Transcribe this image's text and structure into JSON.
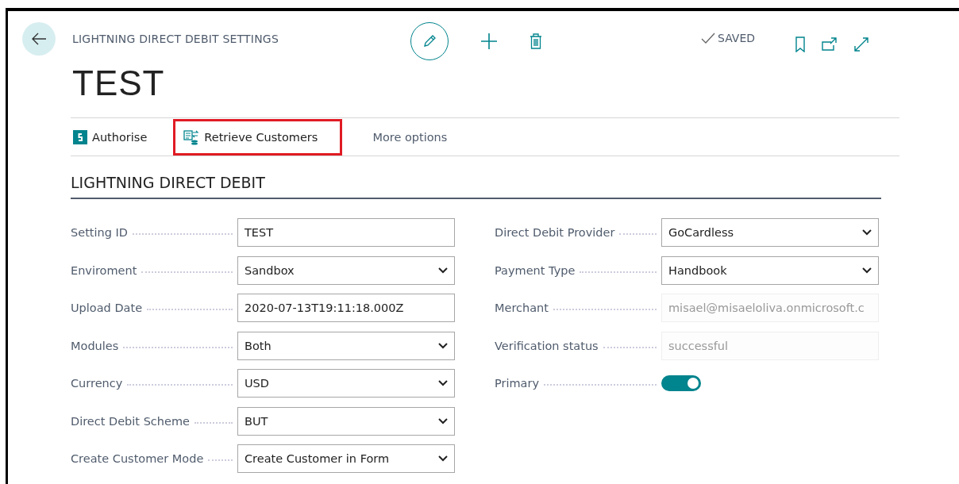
{
  "header": {
    "caption": "LIGHTNING DIRECT DEBIT SETTINGS",
    "title": "TEST",
    "status": "SAVED"
  },
  "actions": [
    {
      "label": "Authorise",
      "kind": "authorise",
      "highlighted": false
    },
    {
      "label": "Retrieve Customers",
      "kind": "retrieve",
      "highlighted": true
    },
    {
      "label": "More options",
      "kind": "more",
      "highlighted": false
    }
  ],
  "section": {
    "title": "LIGHTNING DIRECT DEBIT",
    "left": [
      {
        "label": "Setting ID",
        "kind": "text",
        "value": "TEST"
      },
      {
        "label": "Enviroment",
        "kind": "select",
        "value": "Sandbox"
      },
      {
        "label": "Upload Date",
        "kind": "text",
        "value": "2020-07-13T19:11:18.000Z"
      },
      {
        "label": "Modules",
        "kind": "select",
        "value": "Both"
      },
      {
        "label": "Currency",
        "kind": "select",
        "value": "USD"
      },
      {
        "label": "Direct Debit Scheme",
        "kind": "select",
        "value": "BUT"
      },
      {
        "label": "Create Customer Mode",
        "kind": "select",
        "value": "Create Customer in Form"
      }
    ],
    "right": [
      {
        "label": "Direct Debit Provider",
        "kind": "select",
        "value": "GoCardless"
      },
      {
        "label": "Payment Type",
        "kind": "select",
        "value": "Handbook"
      },
      {
        "label": "Merchant",
        "kind": "readonly",
        "value": "misael@misaeloliva.onmicrosoft.c"
      },
      {
        "label": "Verification status",
        "kind": "readonly",
        "value": "successful"
      },
      {
        "label": "Primary",
        "kind": "toggle",
        "on": true
      }
    ]
  }
}
